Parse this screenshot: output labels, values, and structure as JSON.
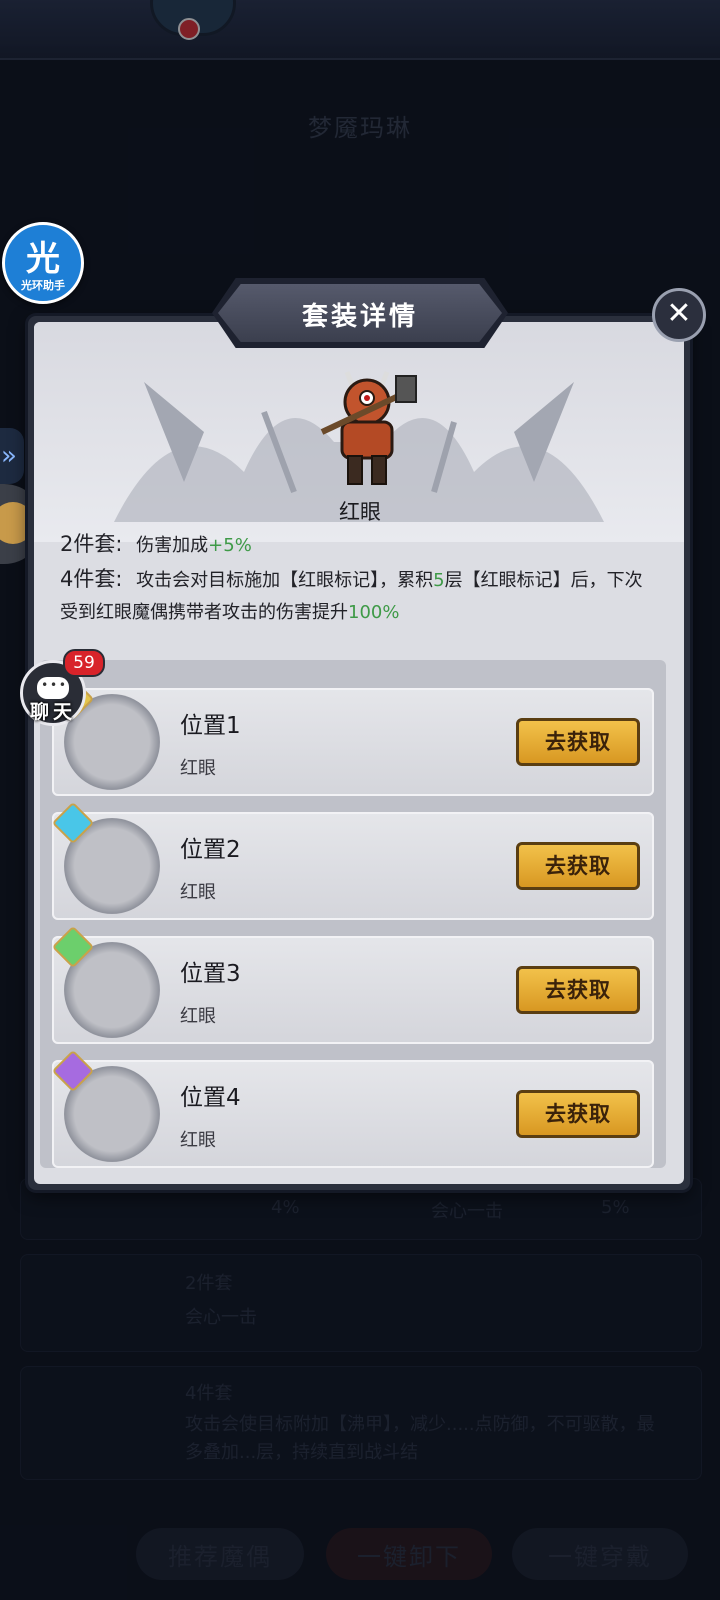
{
  "background": {
    "title": "梦魇玛琳",
    "rows": [
      {
        "label": "2件套",
        "text": "会心一击"
      },
      {
        "label": "4件套",
        "text": "攻击会使目标附加【沸甲】，减少.....点防御，不可驱散，最多叠加...层，持续直到战斗结"
      }
    ],
    "stat_left": "4%",
    "stat_right": "5%",
    "stat_mid": "会心一击",
    "buttons": [
      "推荐魔偶",
      "一键卸下",
      "一键穿戴"
    ]
  },
  "assistant": {
    "glyph": "光",
    "label": "光环助手"
  },
  "chat": {
    "label": "聊天",
    "badge": "59"
  },
  "modal": {
    "title": "套装详情",
    "close_glyph": "✕",
    "set_name": "红眼",
    "bonus_2": {
      "label": "2件套:",
      "text": "伤害加成",
      "value": "+5%"
    },
    "bonus_4": {
      "label": "4件套:",
      "text_a": "攻击会对目标施加【红眼标记】，累积",
      "value_a": "5",
      "text_b": "层【红眼标记】后，下次受到红眼魔偶携带者攻击的伤害提升",
      "value_b": "100%"
    },
    "slots": [
      {
        "name": "位置1",
        "sub": "红眼",
        "button": "去获取",
        "gem_color": "#e3c44b"
      },
      {
        "name": "位置2",
        "sub": "红眼",
        "button": "去获取",
        "gem_color": "#49c6e8"
      },
      {
        "name": "位置3",
        "sub": "红眼",
        "button": "去获取",
        "gem_color": "#6ccf6c"
      },
      {
        "name": "位置4",
        "sub": "红眼",
        "button": "去获取",
        "gem_color": "#a66be0"
      }
    ]
  },
  "colors": {
    "accent_green": "#3e9a47",
    "button_gold": "#e6ad33",
    "badge_red": "#d8232a"
  }
}
